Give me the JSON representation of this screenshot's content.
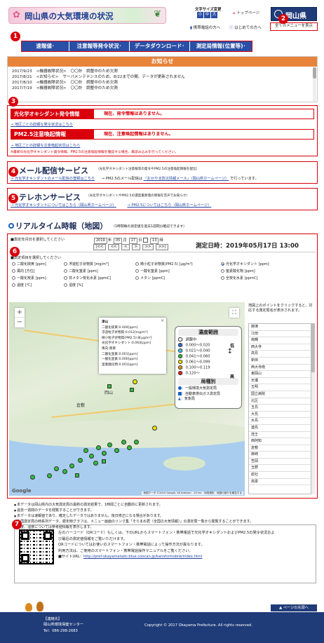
{
  "header": {
    "site_title": "岡山県の大気環境の状況",
    "font_size_label": "文字サイズ変更",
    "font_sizes": [
      "小",
      "中",
      "大"
    ],
    "top_link": "トップページ",
    "mobile_link": "携帯電話の方へ",
    "first_time_link": "はじめての方へ",
    "all_menu_button": "全てのメニューを表示",
    "pref_logo": "岡山県"
  },
  "nav": {
    "items": [
      "速報値･",
      "注意報等発令状況･",
      "データダウンロード･",
      "測定局情報(位置等)･"
    ]
  },
  "notice": {
    "title": "お知らせ",
    "rows": [
      {
        "date": "2017/9/23",
        "tag": "<機器故障状況>",
        "text": "〇〇計　調整中のため欠測"
      },
      {
        "date": "2017/8/21",
        "tag": "<お知らせ>",
        "text": "サーバメンテナンスのため、8/22までの間、データが更新されません"
      },
      {
        "date": "2017/8/10",
        "tag": "<機器故障状況>",
        "text": "〇〇計　調整中のため欠測"
      },
      {
        "date": "2017/7/19",
        "tag": "<機器故障状況>",
        "text": "〇〇計　調整中のため欠測"
      }
    ]
  },
  "alerts": {
    "ox_label": "光化学オキシダント発令情報",
    "ox_status": "現在、発令情報はありません。",
    "ox_link": "→ 地区ごとの詳細な発令状況はこちら",
    "pm_label": "PM2.5注意喚起情報",
    "pm_status": "現在、注意喚起情報はありません。",
    "pm_link": "→ 地区ごとの詳細な注意喚起状況はこちら",
    "pm_note": "※最新の光化学オキシダント発令情報、PM2.5の注意喚起情報を確認する場合、再読み込みを行ってください。"
  },
  "mail": {
    "title": "メール配信サービス",
    "subtitle": "（光化学オキシダント注意報等の発令やPM2.5の注意喚起情報を配信）",
    "link1": "→ 光化学オキシダントのメール配信の登録はこちら",
    "text2": "→ PM2.5のメール配信は",
    "link2": "『おかやま防災情報メール』（岡山県ホームページ）",
    "text3": "で行っています。"
  },
  "tel": {
    "title": "テレホンサービス",
    "subtitle": "（光化学オキシダントやPM2.5の濃度最新値の情報を音声でお知らせ）",
    "link1": "→ 光化学オキシダントについてはこちら（岡山県ホームページ）",
    "link2": "→ PM2.5についてはこちら（岡山県ホームページ）"
  },
  "realtime": {
    "title": "リアルタイム時報（地図）",
    "subtitle": "（1時間毎の測定値を過去1週間分確認できます）",
    "date_prompt": "■測定年月日を選択してください",
    "year": "2019",
    "year_unit": "年",
    "month": "05",
    "month_unit": "月",
    "day": "17",
    "day_unit": "日",
    "hour": "13",
    "hour_unit": "時",
    "nav_buttons": [
      "|<<",
      "<<",
      "<",
      ">",
      ">>",
      ">>|"
    ],
    "measure_label": "測定日時：",
    "measure_value": "2019年05月17日 13:00",
    "item_prompt": "■測定項目を選択してください",
    "items": [
      {
        "label": "二酸化硫黄 [ppm]",
        "type": "radio",
        "on": false
      },
      {
        "label": "浮遊粒子状物質 [mg/m³]",
        "type": "radio",
        "on": false
      },
      {
        "label": "微小粒子状物質(PM2.5) [μg/m³]",
        "type": "radio",
        "on": false
      },
      {
        "label": "光化学オキシダント [ppm]",
        "type": "radio",
        "on": true
      },
      {
        "label": "風向 [方位]",
        "type": "radio",
        "on": false
      },
      {
        "label": "二酸化窒素 [ppm]",
        "type": "radio",
        "on": false
      },
      {
        "label": "一酸化窒素 [ppm]",
        "type": "radio",
        "on": false
      },
      {
        "label": "窒素酸化物 [ppm]",
        "type": "radio",
        "on": false
      },
      {
        "label": "一酸化炭素 [ppm]",
        "type": "radio",
        "on": false
      },
      {
        "label": "非メタン炭化水素 [ppmC]",
        "type": "radio",
        "on": false
      },
      {
        "label": "メタン [ppmC]",
        "type": "radio",
        "on": false
      },
      {
        "label": "全炭化水素 [ppmC]",
        "type": "radio",
        "on": false
      },
      {
        "label": "温度 [℃]",
        "type": "radio",
        "on": false
      },
      {
        "label": "湿度 [%]",
        "type": "radio",
        "on": false
      }
    ]
  },
  "map": {
    "zoom_in": "+",
    "zoom_out": "−",
    "fullscreen": "⛶",
    "google": "Google",
    "attribution": "地図データ ©2019 Google, SK telecom　20 km　利用規約　地図の誤りを報告する",
    "cities": [
      "津山",
      "岡山",
      "倉敷"
    ],
    "popup": {
      "station": "津山",
      "lines": [
        "二酸化硫黄:0.004[ppm]",
        "浮遊粒子状物質:0.012[mg/m³]",
        "微小粒子状物質(PM2.5):8[μg/m³]",
        "光化学オキシダント:0.064[ppm]",
        "風向:南東",
        "二酸化窒素:0.001[ppm]",
        "一酸化窒素:0.000[ppm]",
        "窒素酸化物:0.001[ppm]"
      ]
    },
    "legend": {
      "title": "濃度範囲",
      "ranges": [
        {
          "label": "：調整中",
          "color": "#ffffff"
        },
        {
          "label": "：0.000〜0.020",
          "color": "#2b6de0"
        },
        {
          "label": "：0.021〜0.040",
          "color": "#35c8e8"
        },
        {
          "label": "：0.041〜0.060",
          "color": "#2fbf3a"
        },
        {
          "label": "：0.061〜0.099",
          "color": "#f2e600"
        },
        {
          "label": "：0.100〜0.119",
          "color": "#f0931a"
        },
        {
          "label": "：0.120〜",
          "color": "#e81c1c"
        }
      ],
      "low": "低",
      "high": "高",
      "type_title": "局種別",
      "types": [
        {
          "label": "：一般環境大気測定局",
          "shape": "circle"
        },
        {
          "label": "：自動車排出ガス測定局",
          "shape": "square"
        },
        {
          "label": "：気象局",
          "shape": "triangle"
        }
      ]
    },
    "side_note": "地図上のポイントをクリックすると、対応する測定局名が表示されます。",
    "stations": [
      "御津",
      "江田",
      "南輝",
      "西大寺",
      "高島",
      "新田",
      "西大寺南",
      "東岡山",
      "天瀬",
      "五明",
      "国立病院",
      "北区",
      "玉島",
      "大島",
      "水島",
      "連島",
      "茂王",
      "西阿知",
      "倉敷",
      "御崎",
      "笠岡",
      "玉野",
      "総社",
      "高梁"
    ]
  },
  "notes": [
    "本データは岡山県内の大気測定局の最新の測定結果で、1時間ごとに自動的に更新されます。",
    "過去一週間のデータを閲覧することができます。",
    "本データは速報値であり、確定したデータではありません。後日修正になる場合があります。",
    "全国測定局の時系列データ、経年時グラフは、メニュー画面のリンク集「そらまめ君（全国の大気情報）」の測定局一覧から閲覧することができます。",
    "温度、湿度については参考値情報を表示します。"
  ],
  "qr": {
    "line1": "左のバーコード（QRコード）もしくは、下のURLからスマートフォン・携帯電話で光化学オキシダントおよびPM2.5の発令状況およ",
    "line2": "び最近の測定値情報をご覧いただけます。",
    "line3": "QRコードについてはお使いのスマートフォン・携帯電話によって操作方法が異なります。",
    "line4": "利用方法は、ご使用のスマートフォン・携帯電話操作マニュアルをご覧ください。",
    "url_label": "■サイトURL：",
    "url": "http://pref-okayamataiki.blue.coocan.jp/kanshi/mobile/index.html"
  },
  "page_top": "ページの先頭へ",
  "footer": {
    "contact_label": "【連絡先】",
    "org": "岡山県環境保健センター",
    "tel": "Tel：086-298-2683",
    "copyright": "Copyright © 2017 Okayama Prefecture. All rights reserved."
  },
  "badges": [
    "1",
    "2",
    "3",
    "4",
    "5",
    "6",
    "7"
  ],
  "colors": {
    "accent_red": "#d9000b",
    "nav_blue": "#2a4fa6",
    "notice_orange": "#e8833a",
    "footer_navy": "#1f3b78"
  }
}
